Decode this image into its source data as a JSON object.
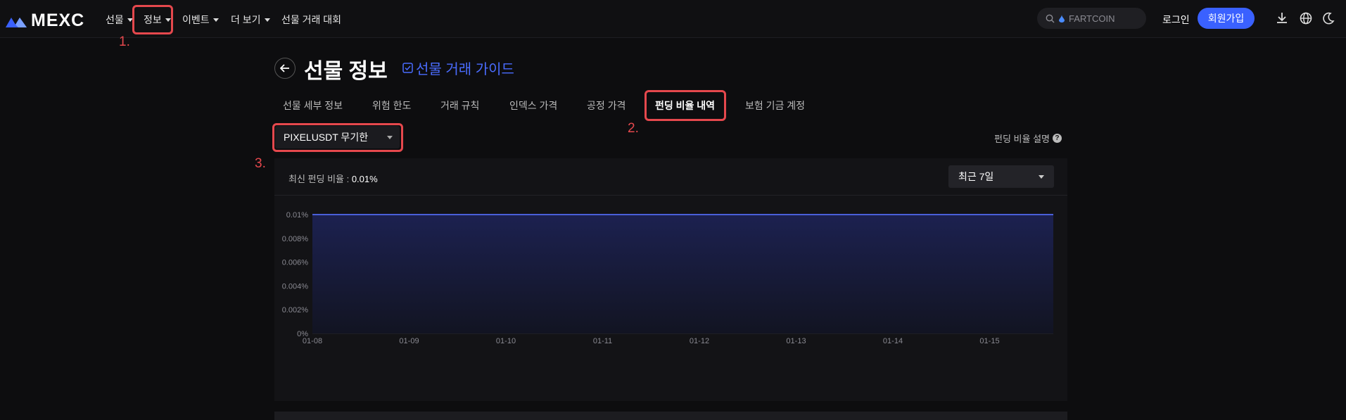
{
  "brand": {
    "name": "MEXC"
  },
  "nav": {
    "items": [
      {
        "label": "선물",
        "dropdown": true
      },
      {
        "label": "정보",
        "dropdown": true
      },
      {
        "label": "이벤트",
        "dropdown": true
      },
      {
        "label": "더 보기",
        "dropdown": true
      },
      {
        "label": "선물 거래 대회",
        "dropdown": false
      }
    ],
    "search_placeholder": "FARTCOIN",
    "login_label": "로그인",
    "signup_label": "회원가입",
    "icons": [
      "download-icon",
      "globe-icon",
      "moon-icon"
    ]
  },
  "header": {
    "title": "선물 정보",
    "guide_link": "선물 거래 가이드"
  },
  "tabs": [
    {
      "label": "선물 세부 정보",
      "active": false
    },
    {
      "label": "위험 한도",
      "active": false
    },
    {
      "label": "거래 규칙",
      "active": false
    },
    {
      "label": "인덱스 가격",
      "active": false
    },
    {
      "label": "공정 가격",
      "active": false
    },
    {
      "label": "펀딩 비율 내역",
      "active": true
    },
    {
      "label": "보험 기금 계정",
      "active": false
    }
  ],
  "contract_selector": {
    "value": "PIXELUSDT 무기한"
  },
  "help_link": "펀딩 비율 설명",
  "panel": {
    "latest_label": "최신 펀딩 비율 : ",
    "latest_value": "0.01%",
    "period_value": "최근 7일"
  },
  "annotations": {
    "a1": "1.",
    "a2": "2.",
    "a3": "3."
  },
  "colors": {
    "accent": "#3a61ff",
    "line": "#4a5fd8",
    "annotation": "#e5484d"
  },
  "chart_data": {
    "type": "area",
    "x": [
      "01-08",
      "01-09",
      "01-10",
      "01-11",
      "01-12",
      "01-13",
      "01-14",
      "01-15"
    ],
    "y_ticks": [
      "0%",
      "0.002%",
      "0.004%",
      "0.006%",
      "0.008%",
      "0.01%"
    ],
    "ylim": [
      0,
      0.01
    ],
    "series": [
      {
        "values": [
          0.01,
          0.01,
          0.01,
          0.01,
          0.01,
          0.01,
          0.01,
          0.01,
          0.01
        ]
      }
    ],
    "grid": true
  }
}
